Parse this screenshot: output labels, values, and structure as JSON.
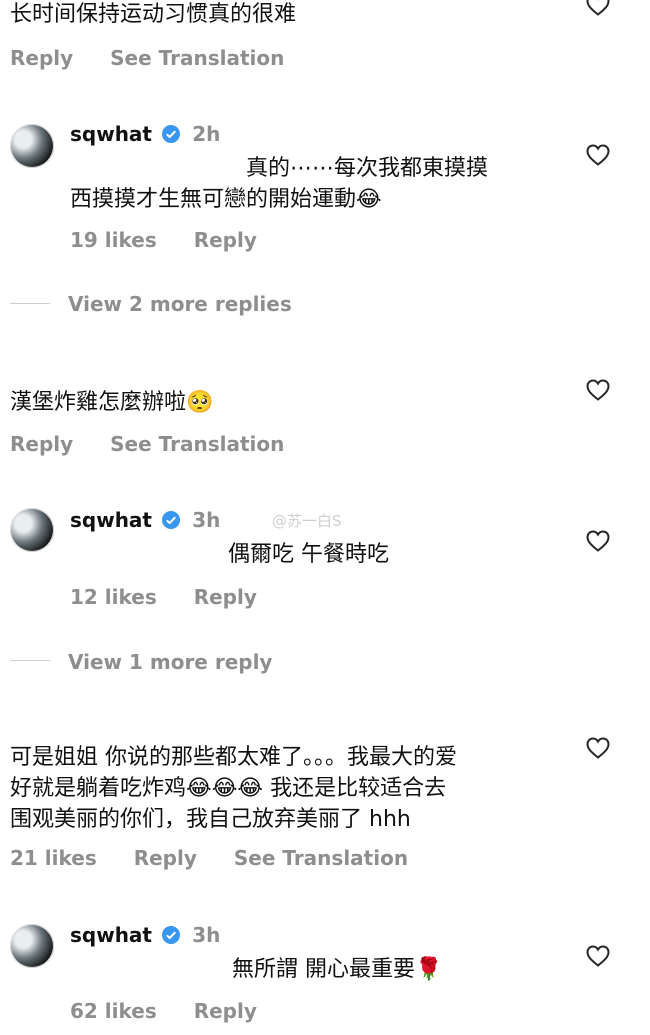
{
  "comments": [
    {
      "text_lines": [
        "长时间保持运动习惯真的很难"
      ],
      "actions": [
        "Reply",
        "See Translation"
      ]
    },
    {
      "username": "sqwhat",
      "time": "2h",
      "text_lines": [
        "真的⋯⋯每次我都東摸摸",
        "西摸摸才生無可戀的開始運動😂"
      ],
      "likes": "19 likes",
      "reply": "Reply"
    },
    {
      "view_replies": "View 2 more replies"
    },
    {
      "text_lines": [
        "漢堡炸雞怎麼辦啦🥺"
      ],
      "actions": [
        "Reply",
        "See Translation"
      ]
    },
    {
      "username": "sqwhat",
      "time": "3h",
      "text_lines": [
        "偶爾吃 午餐時吃"
      ],
      "likes": "12 likes",
      "reply": "Reply"
    },
    {
      "view_replies": "View 1 more reply"
    },
    {
      "text_lines": [
        "可是姐姐 你说的那些都太难了。。。我最大的爱",
        "好就是躺着吃炸鸡😂😂😂 我还是比较适合去",
        "围观美丽的你们，我自己放弃美丽了 hhh"
      ],
      "likes": "21 likes",
      "actions": [
        "Reply",
        "See Translation"
      ]
    },
    {
      "username": "sqwhat",
      "time": "3h",
      "text_lines": [
        "無所謂 開心最重要🌹"
      ],
      "likes": "62 likes",
      "reply": "Reply"
    }
  ],
  "watermark": "@苏一白S",
  "icons": {
    "heart": "heart-outline-icon",
    "verified": "verified-badge-icon"
  },
  "colors": {
    "verified_blue": "#3897f0",
    "meta_gray": "#8e8e8e"
  }
}
